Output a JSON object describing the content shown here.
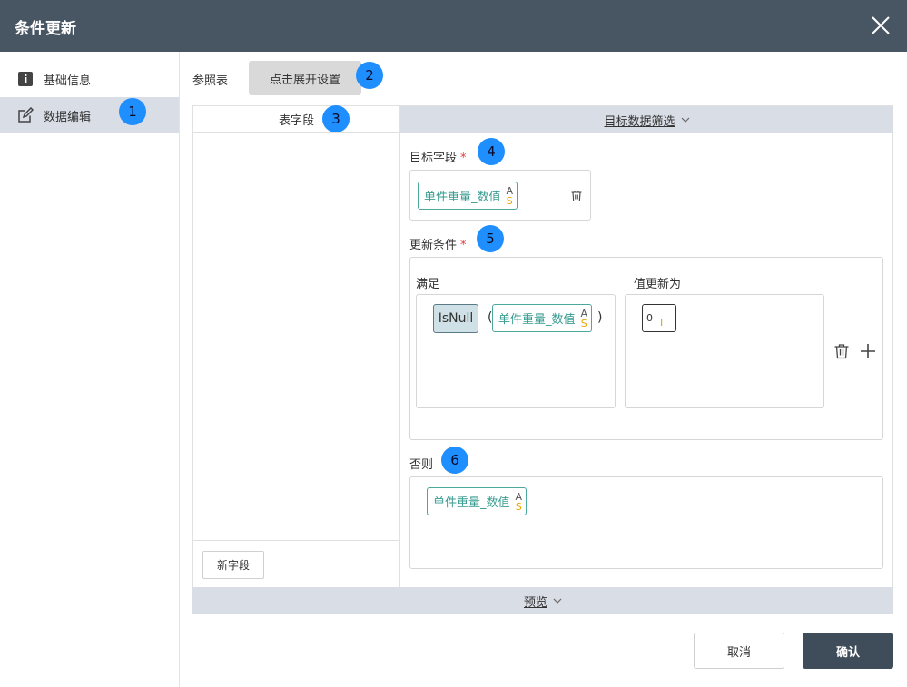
{
  "dialog": {
    "title": "条件更新"
  },
  "sidebar": {
    "items": [
      {
        "label": "基础信息",
        "icon": "info-icon"
      },
      {
        "label": "数据编辑",
        "icon": "edit-icon",
        "active": true
      }
    ]
  },
  "reference": {
    "label": "参照表",
    "button": "点击展开设置"
  },
  "field_panel": {
    "header": "表字段",
    "new_field_button": "新字段"
  },
  "filter_panel": {
    "header": "目标数据筛选"
  },
  "target_field": {
    "label": "目标字段",
    "required_mark": "*",
    "field": {
      "name": "单件重量_数值",
      "type_top": "A",
      "type_bottom": "S"
    }
  },
  "update_condition": {
    "label": "更新条件",
    "required_mark": "*",
    "condition_label": "满足",
    "value_label": "值更新为",
    "function": "IsNull",
    "open_paren": "(",
    "close_paren": ")",
    "arg": {
      "name": "单件重量_数值",
      "type_top": "A",
      "type_bottom": "S"
    },
    "value": {
      "text": "0",
      "type_bottom": "I"
    }
  },
  "otherwise": {
    "label": "否则",
    "field": {
      "name": "单件重量_数值",
      "type_top": "A",
      "type_bottom": "S"
    }
  },
  "preview": {
    "label": "预览"
  },
  "actions": {
    "cancel": "取消",
    "confirm": "确认"
  },
  "badges": [
    "1",
    "2",
    "3",
    "4",
    "5",
    "6"
  ],
  "colors": {
    "titlebar": "#485562",
    "badge": "#1f8fff",
    "chip_border": "#4aa89d",
    "confirm_button": "#3f4d5a",
    "panel_header": "#d9dde6"
  }
}
